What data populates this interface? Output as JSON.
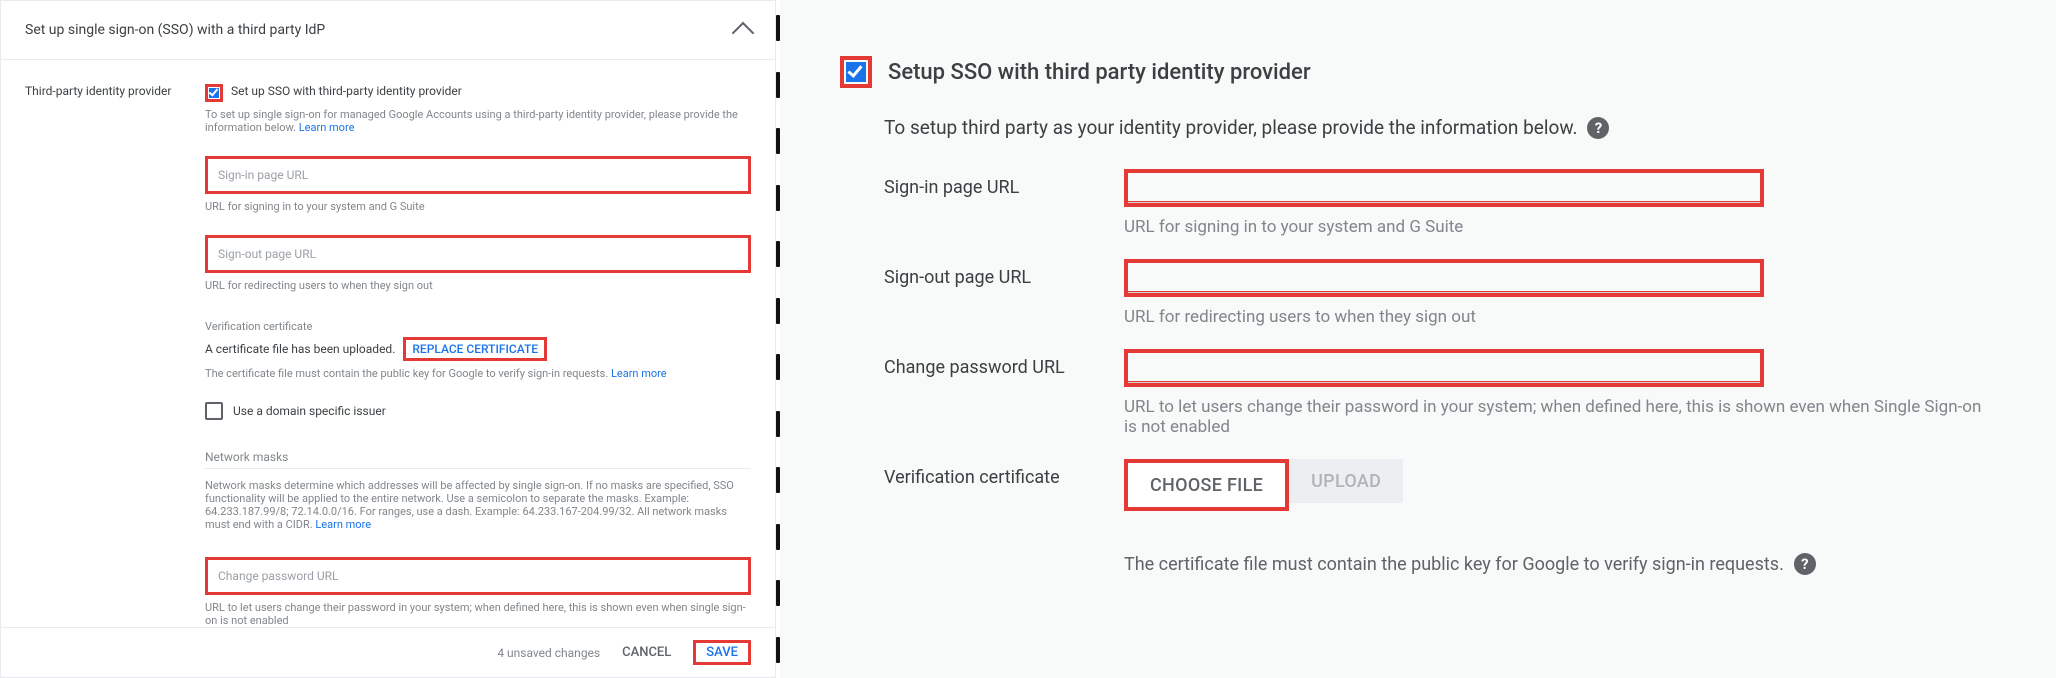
{
  "left": {
    "header": "Set up single sign-on (SSO) with a third party IdP",
    "side_label": "Third-party identity provider",
    "checkbox_label": "Set up SSO with third-party identity provider",
    "help_text": "To set up single sign-on for managed Google Accounts using a third-party identity provider, please provide the information below. ",
    "learn_more": "Learn more",
    "fields": {
      "signin": {
        "placeholder": "Sign-in page URL",
        "caption": "URL for signing in to your system and G Suite"
      },
      "signout": {
        "placeholder": "Sign-out page URL",
        "caption": "URL for redirecting users to when they sign out"
      },
      "cpw": {
        "placeholder": "Change password URL",
        "caption": "URL to let users change their password in your system; when defined here, this is shown even when single sign-on is not enabled"
      }
    },
    "verify": {
      "label": "Verification certificate",
      "uploaded": "A certificate file has been uploaded.",
      "replace_btn": "REPLACE CERTIFICATE",
      "note": "The certificate file must contain the public key for Google to verify sign-in requests. "
    },
    "domain_issuer": "Use a domain specific issuer",
    "nm": {
      "head": "Network masks",
      "body": "Network masks determine which addresses will be affected by single sign-on. If no masks are specified, SSO functionality will be applied to the entire network. Use a semicolon to separate the masks. Example: 64.233.187.99/8; 72.14.0.0/16. For ranges, use a dash. Example: 64.233.167-204.99/32. All network masks must end with a CIDR. "
    },
    "footer": {
      "unsaved": "4 unsaved changes",
      "cancel": "CANCEL",
      "save": "SAVE"
    }
  },
  "right": {
    "title": "Setup SSO with third party identity provider",
    "subtitle": "To setup third party as your identity provider, please provide the information below.",
    "rows": {
      "signin": {
        "label": "Sign-in page URL",
        "caption": "URL for signing in to your system and G Suite"
      },
      "signout": {
        "label": "Sign-out page URL",
        "caption": "URL for redirecting users to when they sign out"
      },
      "cpw": {
        "label": "Change password URL",
        "caption": "URL to let users change their password in your system; when defined here, this is shown even when Single Sign-on is not enabled"
      },
      "verify": {
        "label": "Verification certificate"
      }
    },
    "buttons": {
      "choose": "CHOOSE FILE",
      "upload": "UPLOAD"
    },
    "certnote": "The certificate file must contain the public key for Google to verify sign-in requests."
  }
}
